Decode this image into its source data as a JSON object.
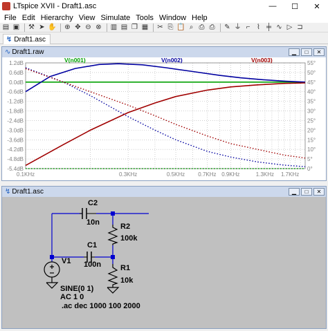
{
  "window": {
    "title": "LTspice XVII - Draft1.asc",
    "minimize": "—",
    "maximize": "☐",
    "close": "✕"
  },
  "menu": [
    "File",
    "Edit",
    "Hierarchy",
    "View",
    "Simulate",
    "Tools",
    "Window",
    "Help"
  ],
  "toolbar_icons": [
    "open-icon",
    "save-icon",
    "control-panel-icon",
    "run-icon",
    "halt-icon",
    "zoom-in-icon",
    "pan-icon",
    "zoom-out-icon",
    "zoom-fit-icon",
    "tile-vertical-icon",
    "tile-horizontal-icon",
    "cascade-icon",
    "close-window-icon",
    "cut-icon",
    "copy-icon",
    "paste-icon",
    "find-icon",
    "print-icon",
    "print-setup-icon",
    "wire-icon",
    "ground-icon",
    "label-icon",
    "resistor-icon",
    "capacitor-icon",
    "inductor-icon",
    "diode-icon",
    "component-icon"
  ],
  "tabs": [
    {
      "label": "Draft1.asc"
    },
    {
      "label": "Draft1.raw"
    }
  ],
  "plot_window": {
    "title": "Draft1.raw"
  },
  "schematic_window": {
    "title": "Draft1.asc"
  },
  "chart_data": {
    "type": "line",
    "x_scale": "log",
    "xlim": [
      100,
      2000
    ],
    "ylim_left": [
      -5.4,
      1.2
    ],
    "ylim_right": [
      0,
      55
    ],
    "grid": true,
    "background": "#ffffff",
    "x_ticks": [
      {
        "x": 100,
        "label": "0.1KHz"
      },
      {
        "x": 300,
        "label": "0.3KHz"
      },
      {
        "x": 500,
        "label": "0.5KHz"
      },
      {
        "x": 700,
        "label": "0.7KHz"
      },
      {
        "x": 900,
        "label": "0.9KHz"
      },
      {
        "x": 1300,
        "label": "1.3KHz"
      },
      {
        "x": 1700,
        "label": "1.7KHz"
      }
    ],
    "y_ticks_left": [
      "1.2dB",
      "0.6dB",
      "0.0dB",
      "-0.6dB",
      "-1.2dB",
      "-1.8dB",
      "-2.4dB",
      "-3.0dB",
      "-3.6dB",
      "-4.2dB",
      "-4.8dB",
      "-5.4dB"
    ],
    "y_ticks_right": [
      "55°",
      "50°",
      "45°",
      "40°",
      "35°",
      "30°",
      "25°",
      "20°",
      "15°",
      "10°",
      "5°",
      "0°"
    ],
    "series": [
      {
        "name": "V(n001)",
        "color": "#00a000",
        "magnitude_db": [
          [
            100,
            0.0
          ],
          [
            2000,
            0.0
          ]
        ],
        "phase_deg": [
          [
            100,
            0
          ],
          [
            2000,
            0
          ]
        ]
      },
      {
        "name": "V(n002)",
        "color": "#0000a0",
        "magnitude_db": [
          [
            100,
            -0.6
          ],
          [
            130,
            0.35
          ],
          [
            170,
            0.85
          ],
          [
            220,
            1.1
          ],
          [
            270,
            1.15
          ],
          [
            350,
            1.08
          ],
          [
            450,
            0.9
          ],
          [
            600,
            0.66
          ],
          [
            800,
            0.42
          ],
          [
            1000,
            0.27
          ],
          [
            1300,
            0.14
          ],
          [
            1600,
            0.06
          ],
          [
            2000,
            0.0
          ]
        ],
        "phase_deg": [
          [
            100,
            52.5
          ],
          [
            150,
            45
          ],
          [
            200,
            38
          ],
          [
            300,
            27
          ],
          [
            400,
            20
          ],
          [
            500,
            15
          ],
          [
            700,
            9
          ],
          [
            900,
            6
          ],
          [
            1200,
            3.5
          ],
          [
            1600,
            1.8
          ],
          [
            2000,
            1
          ]
        ]
      },
      {
        "name": "V(n003)",
        "color": "#a00000",
        "magnitude_db": [
          [
            100,
            -5.2
          ],
          [
            150,
            -3.9
          ],
          [
            200,
            -3.0
          ],
          [
            300,
            -1.9
          ],
          [
            400,
            -1.3
          ],
          [
            500,
            -0.9
          ],
          [
            700,
            -0.5
          ],
          [
            900,
            -0.3
          ],
          [
            1200,
            -0.17
          ],
          [
            1600,
            -0.08
          ],
          [
            2000,
            -0.05
          ]
        ],
        "phase_deg": [
          [
            100,
            52
          ],
          [
            150,
            45
          ],
          [
            200,
            40
          ],
          [
            300,
            33
          ],
          [
            400,
            27.5
          ],
          [
            500,
            23
          ],
          [
            700,
            17
          ],
          [
            900,
            13
          ],
          [
            1200,
            10
          ],
          [
            1600,
            7
          ],
          [
            2000,
            5.5
          ]
        ]
      }
    ]
  },
  "schematic": {
    "labels": {
      "c2_name": "C2",
      "c2_value": "10n",
      "c1_name": "C1",
      "c1_value": "100n",
      "r2_name": "R2",
      "r2_value": "100k",
      "r1_name": "R1",
      "r1_value": "10k",
      "v1_name": "V1",
      "v1_value": "SINE(0 1)",
      "v1_ac": "AC 1 0",
      "directive": ".ac dec 1000 100 2000"
    },
    "wire_color": "#0000d0",
    "junction_color": "#0000d0",
    "component_color": "#000000"
  }
}
